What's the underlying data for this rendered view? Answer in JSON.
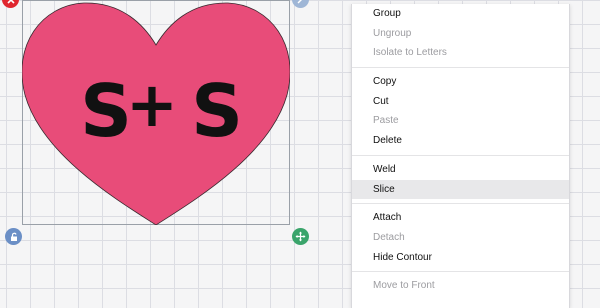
{
  "canvas": {
    "heart_color": "#e84c79",
    "text_color": "#111111",
    "monogram": {
      "left_letter": "S",
      "plus": "+",
      "right_letter": "S"
    },
    "handles": {
      "delete": "close-icon",
      "size": "resize-icon",
      "lock": "unlock-icon",
      "move": "move-icon"
    }
  },
  "context_menu": {
    "groups": [
      [
        {
          "label": "Group",
          "enabled": true
        },
        {
          "label": "Ungroup",
          "enabled": false
        },
        {
          "label": "Isolate to Letters",
          "enabled": false
        }
      ],
      [
        {
          "label": "Copy",
          "enabled": true
        },
        {
          "label": "Cut",
          "enabled": true
        },
        {
          "label": "Paste",
          "enabled": false
        },
        {
          "label": "Delete",
          "enabled": true
        }
      ],
      [
        {
          "label": "Weld",
          "enabled": true
        },
        {
          "label": "Slice",
          "enabled": true,
          "highlighted": true
        }
      ],
      [
        {
          "label": "Attach",
          "enabled": true
        },
        {
          "label": "Detach",
          "enabled": false
        },
        {
          "label": "Hide Contour",
          "enabled": true
        }
      ],
      [
        {
          "label": "Move to Front",
          "enabled": false
        }
      ]
    ]
  }
}
